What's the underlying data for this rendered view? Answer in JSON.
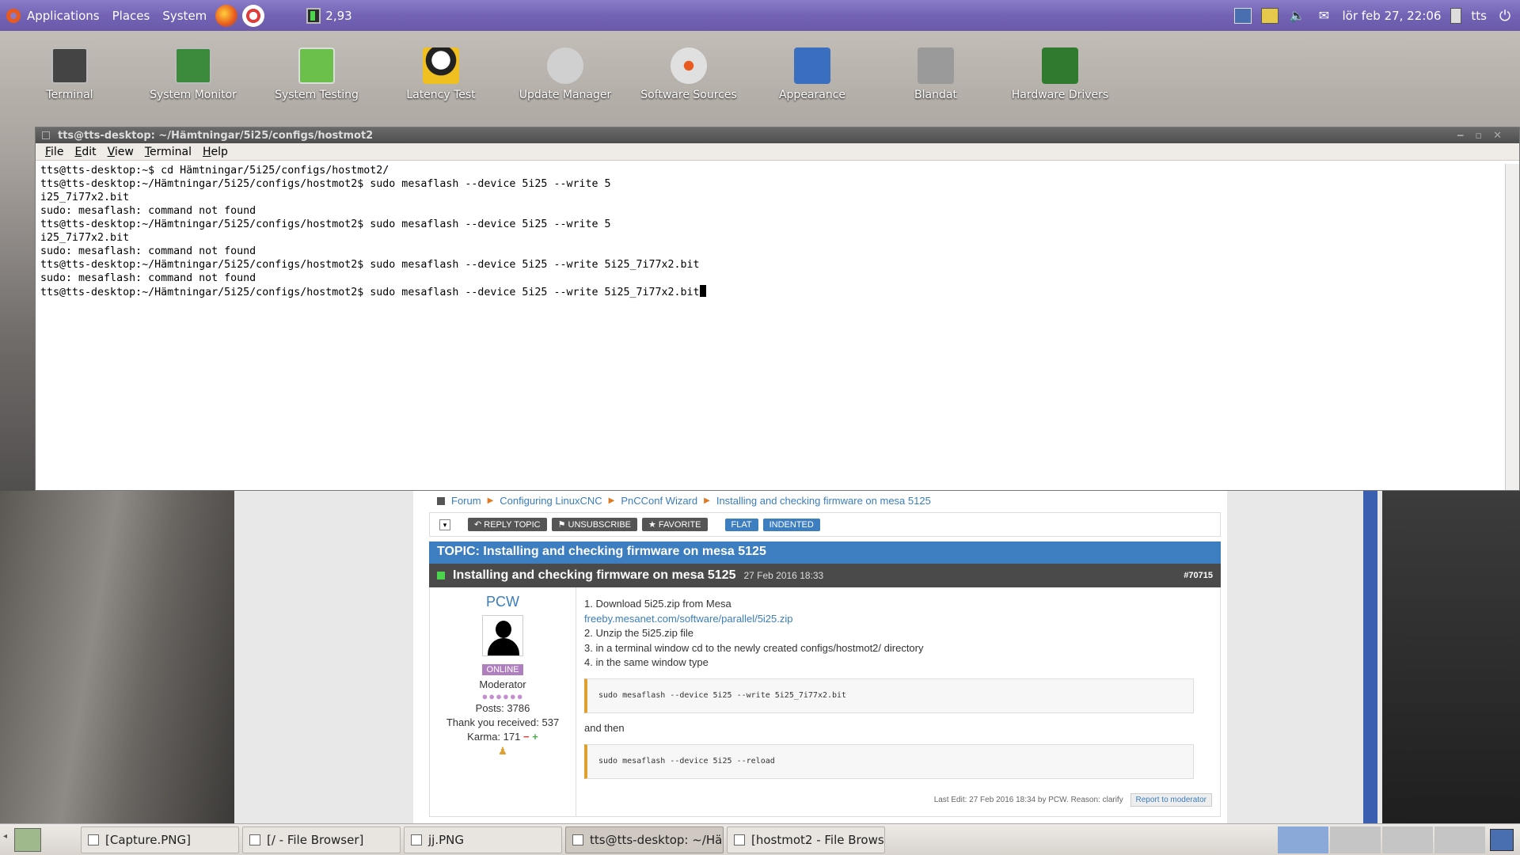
{
  "top_panel": {
    "menus": [
      "Applications",
      "Places",
      "System"
    ],
    "cpu_value": "2,93",
    "clock": "lör feb 27, 22:06",
    "user": "tts"
  },
  "desktop_icons": [
    {
      "label": "Terminal",
      "icon": "terminal-icon",
      "color": "#444444"
    },
    {
      "label": "System Monitor",
      "icon": "system-monitor-icon",
      "color": "#3b8a3b"
    },
    {
      "label": "System Testing",
      "icon": "system-testing-icon",
      "color": "#6bbf4b"
    },
    {
      "label": "Latency Test",
      "icon": "latency-test-icon",
      "color": "#ffffff"
    },
    {
      "label": "Update Manager",
      "icon": "update-manager-icon",
      "color": "#d0d0d0"
    },
    {
      "label": "Software Sources",
      "icon": "software-sources-icon",
      "color": "#e0e0e0"
    },
    {
      "label": "Appearance",
      "icon": "appearance-icon",
      "color": "#3a6fbf"
    },
    {
      "label": "Blandat",
      "icon": "folder-icon",
      "color": "#9a9a9a"
    },
    {
      "label": "Hardware Drivers",
      "icon": "hardware-drivers-icon",
      "color": "#2f7a2f"
    }
  ],
  "terminal": {
    "title": "tts@tts-desktop: ~/Hämtningar/5i25/configs/hostmot2",
    "menu": [
      "File",
      "Edit",
      "View",
      "Terminal",
      "Help"
    ],
    "lines": [
      "tts@tts-desktop:~$ cd Hämtningar/5i25/configs/hostmot2/",
      "tts@tts-desktop:~/Hämtningar/5i25/configs/hostmot2$ sudo mesaflash --device 5i25 --write 5",
      "i25_7i77x2.bit",
      "sudo: mesaflash: command not found",
      "tts@tts-desktop:~/Hämtningar/5i25/configs/hostmot2$ sudo mesaflash --device 5i25 --write 5",
      "i25_7i77x2.bit",
      "sudo: mesaflash: command not found",
      "tts@tts-desktop:~/Hämtningar/5i25/configs/hostmot2$ sudo mesaflash --device 5i25 --write 5i25_7i77x2.bit",
      "sudo: mesaflash: command not found",
      "tts@tts-desktop:~/Hämtningar/5i25/configs/hostmot2$ sudo mesaflash --device 5i25 --write 5i25_7i77x2.bit"
    ]
  },
  "forum": {
    "breadcrumb": [
      "Forum",
      "Configuring LinuxCNC",
      "PnCConf Wizard",
      "Installing and checking firmware on mesa 5125"
    ],
    "toolbar": [
      "REPLY TOPIC",
      "UNSUBSCRIBE",
      "FAVORITE",
      "FLAT",
      "INDENTED"
    ],
    "topic_title": "TOPIC: Installing and checking firmware on mesa 5125",
    "post": {
      "title": "Installing and checking firmware on mesa 5125",
      "date": "27 Feb 2016 18:33",
      "number": "#70715",
      "user": "PCW",
      "status": "ONLINE",
      "role": "Moderator",
      "posts": "Posts: 3786",
      "thanks": "Thank you received: 537",
      "karma": "Karma: 171",
      "body": [
        "1. Download 5i25.zip from Mesa",
        "freeby.mesanet.com/software/parallel/5i25.zip",
        "2. Unzip the 5i25.zip file",
        "3. in a terminal window cd to the newly created configs/hostmot2/ directory",
        "4. in the same window type"
      ],
      "code1": "sudo mesaflash --device 5i25 --write 5i25_7i77x2.bit",
      "and_then": "and then",
      "code2": "sudo mesaflash --device 5i25 --reload",
      "last_edit": "Last Edit: 27 Feb 2016 18:34 by PCW. Reason: clarify",
      "report": "Report to moderator"
    }
  },
  "taskbar": {
    "tasks": [
      {
        "label": "[Capture.PNG]",
        "active": false
      },
      {
        "label": "[/ - File Browser]",
        "active": false
      },
      {
        "label": "jj.PNG",
        "active": false
      },
      {
        "label": "tts@tts-desktop: ~/Hä...",
        "active": true
      },
      {
        "label": "[hostmot2 - File Brows...",
        "active": false
      }
    ]
  }
}
